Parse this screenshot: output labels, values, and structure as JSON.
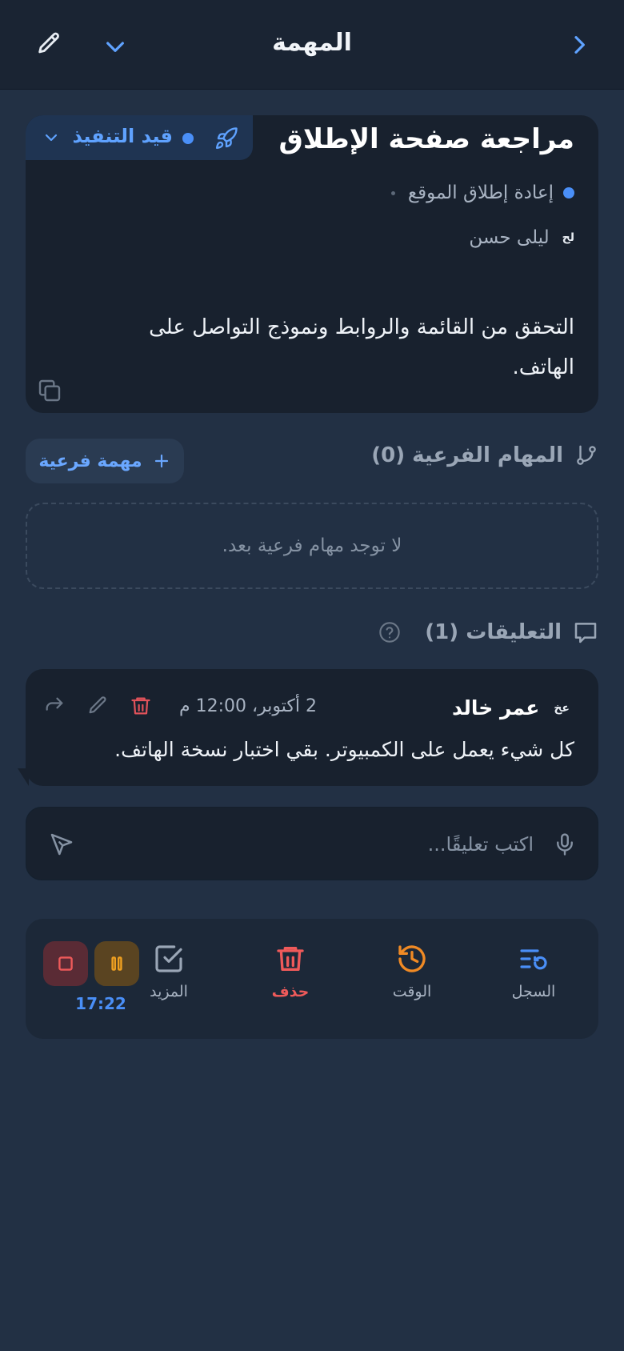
{
  "header": {
    "title": "المهمة"
  },
  "task": {
    "title": "مراجعة صفحة الإطلاق",
    "status": "قيد التنفيذ",
    "project": "إعادة إطلاق الموقع",
    "assignee_initials": "لح",
    "assignee_name": "ليلى حسن",
    "description": "التحقق من القائمة والروابط ونموذج التواصل على الهاتف."
  },
  "subtasks": {
    "label": "المهام الفرعية (0)",
    "add_label": "مهمة فرعية",
    "empty_text": "لا توجد مهام فرعية بعد."
  },
  "comments": {
    "label": "التعليقات (1)",
    "items": [
      {
        "initials": "عخ",
        "author": "عمر خالد",
        "date": "2 أكتوبر، 12:00 م",
        "text": "كل شيء يعمل على الكمبيوتر. بقي اختبار نسخة الهاتف."
      }
    ],
    "input_placeholder": "اكتب تعليقًا..."
  },
  "toolbar": {
    "log_label": "السجل",
    "time_label": "الوقت",
    "delete_label": "حذف",
    "more_label": "المزيد",
    "timer": "17:22"
  },
  "colors": {
    "accent": "#4a8ff7",
    "danger": "#ef5a5a",
    "warning": "#f0a020",
    "background": "#223044",
    "card": "#18212e"
  }
}
